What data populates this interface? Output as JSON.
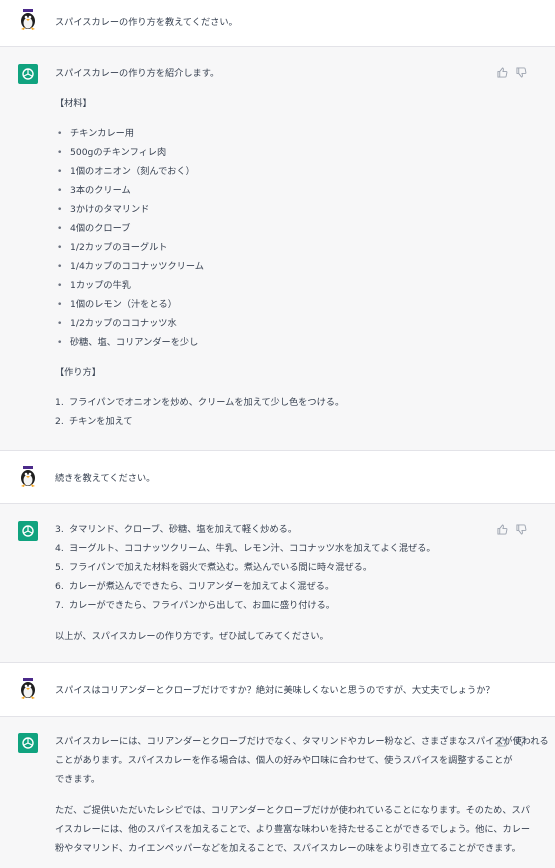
{
  "conversation": {
    "msg1": {
      "role": "user",
      "text": "スパイスカレーの作り方を教えてください。"
    },
    "msg2": {
      "role": "assistant",
      "intro": "スパイスカレーの作り方を紹介します。",
      "materials_heading": "【材料】",
      "materials": [
        "チキンカレー用",
        "500gのチキンフィレ肉",
        "1個のオニオン（刻んでおく）",
        "3本のクリーム",
        "3かけのタマリンド",
        "4個のクローブ",
        "1/2カップのヨーグルト",
        "1/4カップのココナッツクリーム",
        "1カップの牛乳",
        "1個のレモン（汁をとる）",
        "1/2カップのココナッツ水",
        "砂糖、塩、コリアンダーを少し"
      ],
      "method_heading": "【作り方】",
      "steps": [
        {
          "n": "1.",
          "t": "フライパンでオニオンを炒め、クリームを加えて少し色をつける。"
        },
        {
          "n": "2.",
          "t": "チキンを加えて"
        }
      ]
    },
    "msg3": {
      "role": "user",
      "text": "続きを教えてください。"
    },
    "msg4": {
      "role": "assistant",
      "steps": [
        {
          "n": "3.",
          "t": "タマリンド、クローブ、砂糖、塩を加えて軽く炒める。"
        },
        {
          "n": "4.",
          "t": "ヨーグルト、ココナッツクリーム、牛乳、レモン汁、ココナッツ水を加えてよく混ぜる。"
        },
        {
          "n": "5.",
          "t": "フライパンで加えた材料を弱火で煮込む。煮込んでいる間に時々混ぜる。"
        },
        {
          "n": "6.",
          "t": "カレーが煮込んでできたら、コリアンダーを加えてよく混ぜる。"
        },
        {
          "n": "7.",
          "t": "カレーができたら、フライパンから出して、お皿に盛り付ける。"
        }
      ],
      "outro": "以上が、スパイスカレーの作り方です。ぜひ試してみてください。"
    },
    "msg5": {
      "role": "user",
      "text": "スパイスはコリアンダーとクローブだけですか？絶対に美味しくないと思うのですが、大丈夫でしょうか？"
    },
    "msg6": {
      "role": "assistant",
      "para1_lines": [
        "スパイスカレーには、コリアンダーとクローブだけでなく、タマリンドやカレー粉など、さまざまなスパイスが使われる",
        "ことがあります。スパイスカレーを作る場合は、個人の好みや口味に合わせて、使うスパイスを調整することが",
        "できます。"
      ],
      "para2_lines": [
        "ただ、ご提供いただいたレシピでは、コリアンダーとクローブだけが使われていることになります。そのため、スパ",
        "イスカレーには、他のスパイスを加えることで、より豊富な味わいを持たせることができるでしょう。他に、カレー",
        "粉やタマリンド、カイエンペッパーなどを加えることで、スパイスカレーの味をより引き立てることができます。"
      ]
    }
  },
  "icons": {
    "user_avatar": "penguin-avatar-icon",
    "assistant_avatar": "openai-logo-icon",
    "thumbs_up": "thumbs-up-icon",
    "thumbs_down": "thumbs-down-icon"
  },
  "colors": {
    "assistant_avatar_bg": "#10a37f",
    "bot_row_bg": "#f7f7f8",
    "text": "#374151"
  }
}
